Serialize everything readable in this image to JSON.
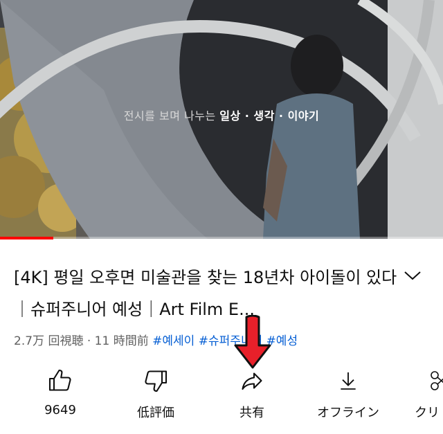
{
  "player": {
    "subtitle_plain": "전시를 보며 나누는 ",
    "subtitle_highlight": "일상 · 생각 · 이야기",
    "progress_fraction": 0.12,
    "progress_color": "#ff0000"
  },
  "video": {
    "title": "[4K] 평일 오후면 미술관을 찾는 18년차 아이돌이 있다｜슈퍼주니어 예성｜Art Film E...",
    "views": "2.7万 回視聴",
    "separator": " · ",
    "time_ago": "11 時間前",
    "hashtags": [
      "#예세이",
      "#슈퍼주니어",
      "#예성"
    ]
  },
  "actions": [
    {
      "icon": "thumbs-up-icon",
      "label": "9649"
    },
    {
      "icon": "thumbs-down-icon",
      "label": "低評価"
    },
    {
      "icon": "share-icon",
      "label": "共有"
    },
    {
      "icon": "download-icon",
      "label": "オフライン"
    },
    {
      "icon": "clip-icon",
      "label": "クリ"
    }
  ],
  "colors": {
    "text": "#0f0f0f",
    "meta": "#606060",
    "hashtag": "#065fd4",
    "annotation_arrow": "#e8202a"
  }
}
